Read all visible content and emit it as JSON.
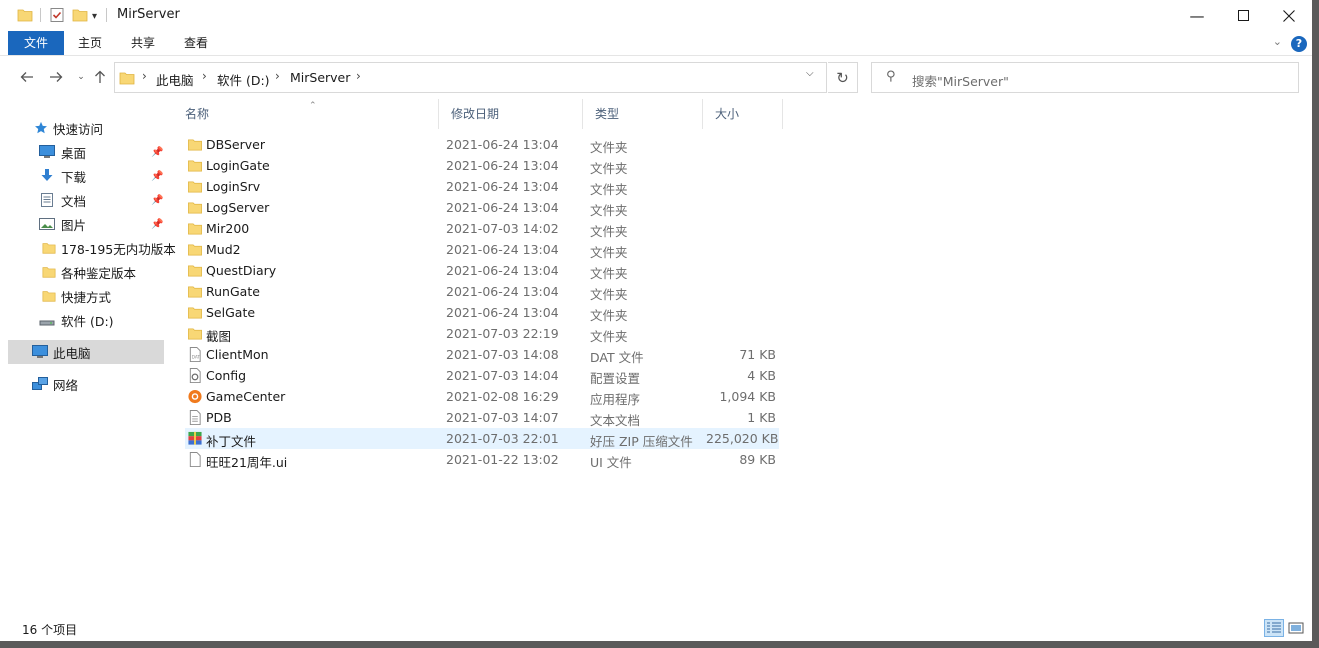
{
  "window": {
    "title": "MirServer"
  },
  "ribbon": {
    "tabs": [
      "文件",
      "主页",
      "共享",
      "查看"
    ],
    "help": "?"
  },
  "address": {
    "segments": [
      "此电脑",
      "软件 (D:)",
      "MirServer"
    ],
    "search_placeholder": "搜索\"MirServer\""
  },
  "sidebar": {
    "items": [
      {
        "label": "快速访问",
        "icon": "star-icon",
        "pinned": false
      },
      {
        "label": "桌面",
        "icon": "desktop-icon",
        "pinned": true
      },
      {
        "label": "下载",
        "icon": "download-icon",
        "pinned": true
      },
      {
        "label": "文档",
        "icon": "document-icon",
        "pinned": true
      },
      {
        "label": "图片",
        "icon": "picture-icon",
        "pinned": true
      },
      {
        "label": "178-195无内功版本",
        "icon": "folder-icon",
        "pinned": false
      },
      {
        "label": "各种鉴定版本",
        "icon": "folder-icon",
        "pinned": false
      },
      {
        "label": "快捷方式",
        "icon": "folder-icon",
        "pinned": false
      },
      {
        "label": "软件 (D:)",
        "icon": "drive-icon",
        "pinned": false
      },
      {
        "label": "此电脑",
        "icon": "computer-icon",
        "pinned": false,
        "selected": true
      },
      {
        "label": "网络",
        "icon": "network-icon",
        "pinned": false
      }
    ]
  },
  "columns": [
    "名称",
    "修改日期",
    "类型",
    "大小"
  ],
  "files": [
    {
      "name": "DBServer",
      "date": "2021-06-24 13:04",
      "type": "文件夹",
      "size": "",
      "icon": "folder-icon"
    },
    {
      "name": "LoginGate",
      "date": "2021-06-24 13:04",
      "type": "文件夹",
      "size": "",
      "icon": "folder-icon"
    },
    {
      "name": "LoginSrv",
      "date": "2021-06-24 13:04",
      "type": "文件夹",
      "size": "",
      "icon": "folder-icon"
    },
    {
      "name": "LogServer",
      "date": "2021-06-24 13:04",
      "type": "文件夹",
      "size": "",
      "icon": "folder-icon"
    },
    {
      "name": "Mir200",
      "date": "2021-07-03 14:02",
      "type": "文件夹",
      "size": "",
      "icon": "folder-icon"
    },
    {
      "name": "Mud2",
      "date": "2021-06-24 13:04",
      "type": "文件夹",
      "size": "",
      "icon": "folder-icon"
    },
    {
      "name": "QuestDiary",
      "date": "2021-06-24 13:04",
      "type": "文件夹",
      "size": "",
      "icon": "folder-icon"
    },
    {
      "name": "RunGate",
      "date": "2021-06-24 13:04",
      "type": "文件夹",
      "size": "",
      "icon": "folder-icon"
    },
    {
      "name": "SelGate",
      "date": "2021-06-24 13:04",
      "type": "文件夹",
      "size": "",
      "icon": "folder-icon"
    },
    {
      "name": "截图",
      "date": "2021-07-03 22:19",
      "type": "文件夹",
      "size": "",
      "icon": "folder-icon"
    },
    {
      "name": "ClientMon",
      "date": "2021-07-03 14:08",
      "type": "DAT 文件",
      "size": "71 KB",
      "icon": "dat-file-icon"
    },
    {
      "name": "Config",
      "date": "2021-07-03 14:04",
      "type": "配置设置",
      "size": "4 KB",
      "icon": "config-file-icon"
    },
    {
      "name": "GameCenter",
      "date": "2021-02-08 16:29",
      "type": "应用程序",
      "size": "1,094 KB",
      "icon": "app-icon"
    },
    {
      "name": "PDB",
      "date": "2021-07-03 14:07",
      "type": "文本文档",
      "size": "1 KB",
      "icon": "text-file-icon"
    },
    {
      "name": "补丁文件",
      "date": "2021-07-03 22:01",
      "type": "好压 ZIP 压缩文件",
      "size": "225,020 KB",
      "icon": "zip-icon",
      "selected": true
    },
    {
      "name": "旺旺21周年.ui",
      "date": "2021-01-22 13:02",
      "type": "UI 文件",
      "size": "89 KB",
      "icon": "blank-file-icon"
    }
  ],
  "status": {
    "count_text": "16 个项目"
  }
}
